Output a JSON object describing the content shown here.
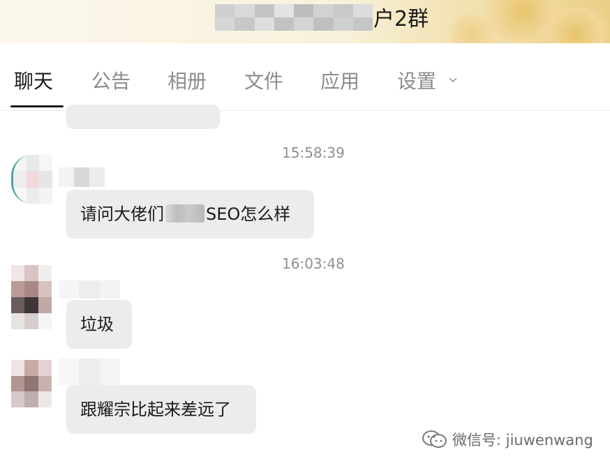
{
  "header": {
    "group_title_suffix": "户2群"
  },
  "tabs": [
    {
      "label": "聊天",
      "active": true
    },
    {
      "label": "公告",
      "active": false
    },
    {
      "label": "相册",
      "active": false
    },
    {
      "label": "文件",
      "active": false
    },
    {
      "label": "应用",
      "active": false
    },
    {
      "label": "设置",
      "active": false,
      "icon": "chevron-down-icon"
    }
  ],
  "messages": [
    {
      "time": "15:58:39",
      "text_before": "请问大佬们",
      "text_after": "SEO怎么样"
    },
    {
      "time": "16:03:48",
      "text": "垃圾"
    },
    {
      "text": "跟耀宗比起来差远了"
    }
  ],
  "watermark": {
    "icon": "wechat-official-account-icon",
    "text": "微信号: jiuwenwang"
  },
  "colors": {
    "bubble": "#ececec",
    "timestamp": "#8f8f8f",
    "tab_inactive": "#8c8c8c",
    "tab_active": "#1a1a1a"
  }
}
